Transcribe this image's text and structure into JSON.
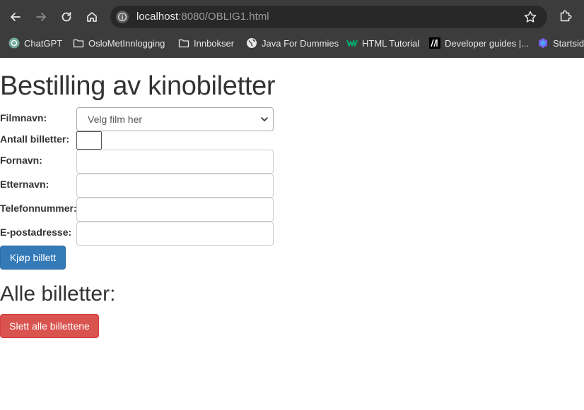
{
  "browser": {
    "url_host": "localhost",
    "url_rest": ":8080/OBLIG1.html",
    "bookmarks": [
      {
        "label": "ChatGPT",
        "icon": "chatgpt-icon"
      },
      {
        "label": "OsloMetInnlogging",
        "icon": "folder-icon"
      },
      {
        "label": "Innbokser",
        "icon": "folder-icon"
      },
      {
        "label": "Java For Dummies",
        "icon": "globe-icon"
      },
      {
        "label": "HTML Tutorial",
        "icon": "w3schools-icon"
      },
      {
        "label": "Developer guides |...",
        "icon": "mdn-icon"
      },
      {
        "label": "Startside",
        "icon": "copilot-icon"
      }
    ]
  },
  "page": {
    "title": "Bestilling av kinobiletter",
    "form": {
      "film_label": "Filmnavn:",
      "film_selected": "Velg film her",
      "antall_label": "Antall billetter:",
      "fornavn_label": "Fornavn:",
      "etternavn_label": "Etternavn:",
      "telefon_label": "Telefonnummer:",
      "epost_label": "E-postadresse:",
      "submit_label": "Kjøp billett"
    },
    "list_title": "Alle billetter:",
    "delete_label": "Slett alle billettene"
  },
  "colors": {
    "primary": "#337ab7",
    "danger": "#d9534f",
    "chrome": "#3c3c3c"
  }
}
